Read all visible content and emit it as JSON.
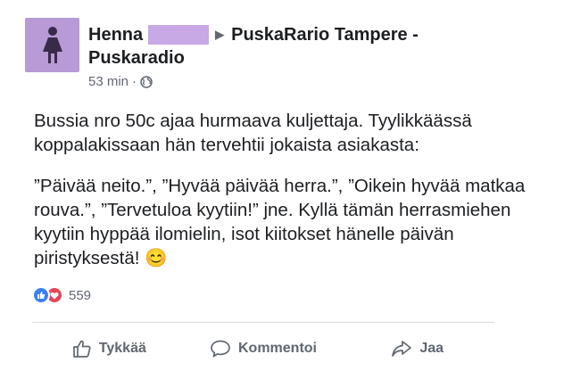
{
  "post": {
    "author": "Henna",
    "group": "PuskaRario Tampere -",
    "group_line2": "Puskaradio",
    "time": "53 min",
    "separator": "·",
    "paragraph1": "Bussia nro 50c ajaa hurmaava kuljettaja. Tyylikkäässä koppalakissaan hän tervehtii jokaista asiakasta:",
    "paragraph2": "”Päivää neito.”, ”Hyvää päivää herra.”, ”Oikein hyvää matkaa rouva.”, ”Tervetuloa kyytiin!” jne. Kyllä tämän herrasmiehen kyytiin hyppää ilomielin, isot kiitokset hänelle päivän piristyksestä!",
    "emoji": "😊"
  },
  "reactions": {
    "icons": [
      "like-icon",
      "love-icon"
    ],
    "count": "559"
  },
  "actions": {
    "like": "Tykkää",
    "comment": "Kommentoi",
    "share": "Jaa"
  },
  "colors": {
    "avatar": "#b89ad6",
    "redaction": "#c9a8e6",
    "like": "#3b7ff0",
    "love": "#e64558"
  }
}
